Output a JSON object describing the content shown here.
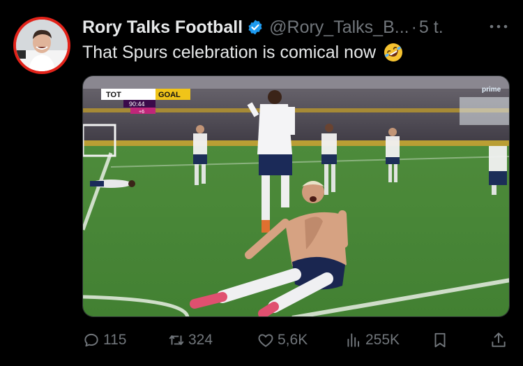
{
  "author": {
    "display_name": "Rory Talks Football",
    "handle": "@Rory_Talks_B...",
    "separator": "·",
    "time": "5 t."
  },
  "tweet": {
    "text": "That Spurs celebration is comical now"
  },
  "media": {
    "scoreboard_home": "TOT",
    "scoreboard_event": "GOAL",
    "scoreboard_clock": "90:44",
    "scoreboard_added": "+6",
    "broadcaster": "prime"
  },
  "stats": {
    "replies": "115",
    "retweets": "324",
    "likes": "5,6K",
    "views": "255K"
  },
  "colors": {
    "background": "#000000",
    "text": "#e7e9ea",
    "muted": "#71767b",
    "verified": "#1d9bf0",
    "avatar_ring": "#e2231a"
  },
  "icons": {
    "verified": "verified-badge-icon",
    "more": "more-dots-icon",
    "reply": "reply-bubble-icon",
    "retweet": "retweet-icon",
    "like": "heart-icon",
    "views": "views-chart-icon",
    "bookmark": "bookmark-icon",
    "share": "share-icon",
    "emoji": "rolling-laughing-emoji"
  }
}
